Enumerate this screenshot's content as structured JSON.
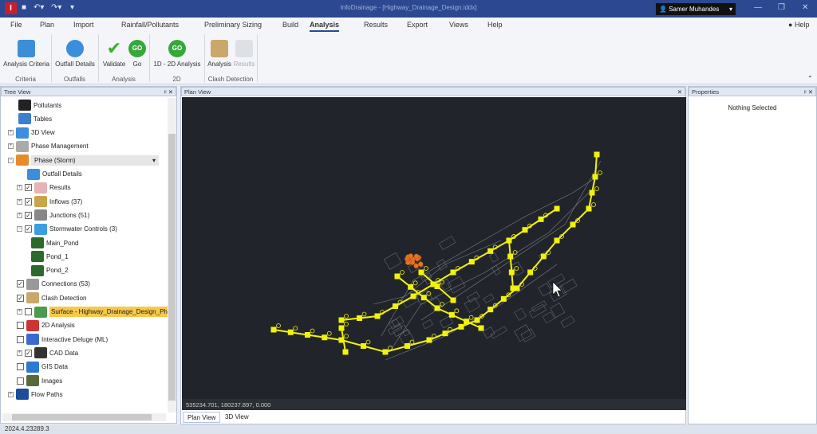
{
  "titlebar": {
    "title": "InfoDrainage - [Highway_Drainage_Design.iddx]",
    "app_icon": "I",
    "user": "Samer Muhandes",
    "help": "Help"
  },
  "menu": [
    "File",
    "Plan",
    "Import",
    "Rainfall/Pollutants",
    "Preliminary Sizing",
    "Build",
    "Analysis",
    "Results",
    "Export",
    "Views",
    "Help"
  ],
  "ribbon": {
    "buttons": [
      "Analysis Criteria",
      "Outfall Details",
      "Validate",
      "Go",
      "1D - 2D Analysis",
      "Analysis",
      "Results"
    ],
    "groups": [
      "Criteria",
      "Outfalls",
      "Analysis",
      "2D",
      "Clash Detection"
    ]
  },
  "tree": {
    "title": "Tree View",
    "items": [
      {
        "label": "Pollutants"
      },
      {
        "label": "Tables"
      },
      {
        "label": "3D View"
      },
      {
        "label": "Phase Management"
      },
      {
        "label": "Phase (Storm)"
      },
      {
        "label": "Outfall Details"
      },
      {
        "label": "Results",
        "checked": true
      },
      {
        "label": "Inflows (37)",
        "checked": true
      },
      {
        "label": "Junctions (51)",
        "checked": true
      },
      {
        "label": "Stormwater Controls (3)",
        "checked": true
      },
      {
        "label": "Main_Pond"
      },
      {
        "label": "Pond_1"
      },
      {
        "label": "Pond_2"
      },
      {
        "label": "Connections (53)",
        "checked": true
      },
      {
        "label": "Clash Detection",
        "checked": true
      },
      {
        "label": "Surface - Highway_Drainage_Design_Phase.id",
        "checked": false
      },
      {
        "label": "2D Analysis",
        "checked": false
      },
      {
        "label": "Interactive Deluge (ML)",
        "checked": false
      },
      {
        "label": "CAD Data",
        "checked": true
      },
      {
        "label": "GIS Data",
        "checked": false
      },
      {
        "label": "Images",
        "checked": false
      },
      {
        "label": "Flow Paths"
      }
    ]
  },
  "plan": {
    "title": "Plan View",
    "coords": "535234.701, 180237.897, 0.000",
    "tabs": [
      "Plan View",
      "3D View"
    ]
  },
  "properties": {
    "title": "Properties",
    "empty": "Nothing Selected"
  },
  "status": {
    "version": "2024.4.23289.3"
  },
  "colors": {
    "accent": "#2b4890",
    "network": "#f2f20a",
    "canvas": "#21252b",
    "highlight": "#f7c948"
  }
}
